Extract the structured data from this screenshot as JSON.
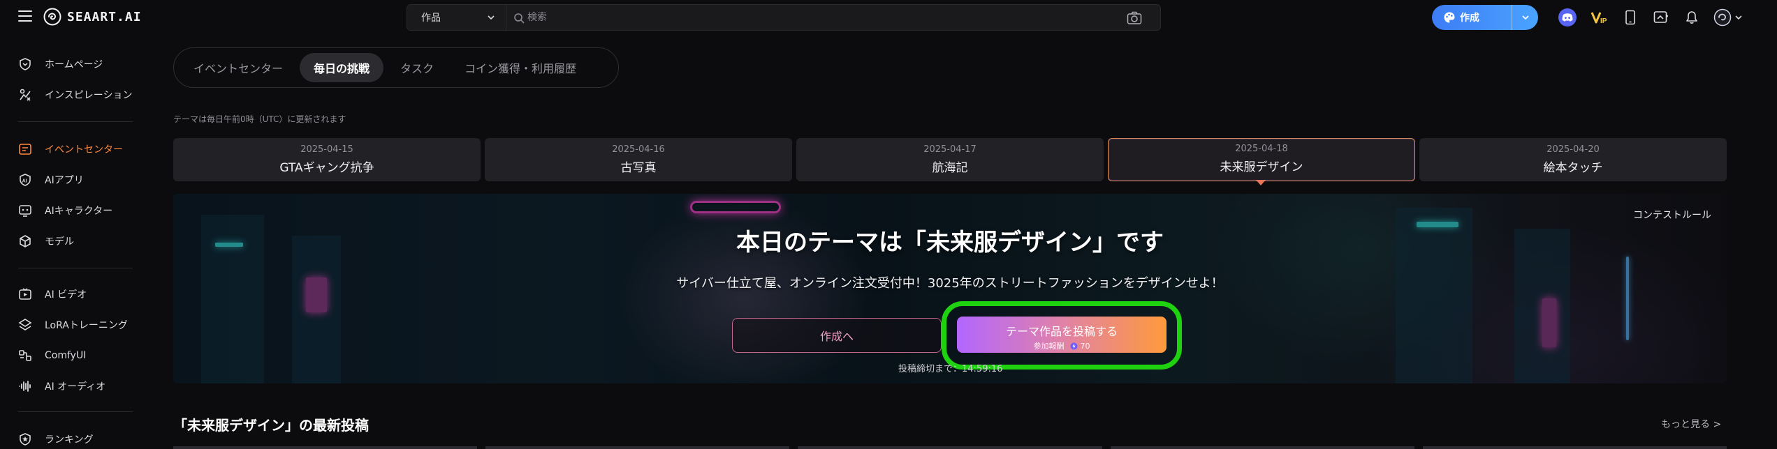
{
  "header": {
    "logo_text": "SEAART.AI",
    "search_type": "作品",
    "search_placeholder": "検索",
    "create_label": "作成"
  },
  "sidebar": {
    "items": [
      {
        "label": "ホームページ",
        "icon": "home-icon"
      },
      {
        "label": "インスピレーション",
        "icon": "inspiration-icon"
      },
      {
        "label": "イベントセンター",
        "icon": "event-center-icon",
        "active": true
      },
      {
        "label": "AIアプリ",
        "icon": "ai-app-icon"
      },
      {
        "label": "AIキャラクター",
        "icon": "ai-character-icon"
      },
      {
        "label": "モデル",
        "icon": "model-icon"
      },
      {
        "label": "AI ビデオ",
        "icon": "ai-video-icon"
      },
      {
        "label": "LoRAトレーニング",
        "icon": "lora-training-icon"
      },
      {
        "label": "ComfyUI",
        "icon": "comfyui-icon"
      },
      {
        "label": "AI オーディオ",
        "icon": "ai-audio-icon"
      },
      {
        "label": "ランキング",
        "icon": "ranking-icon"
      }
    ]
  },
  "tabs": [
    {
      "label": "イベントセンター"
    },
    {
      "label": "毎日の挑戦",
      "active": true
    },
    {
      "label": "タスク"
    },
    {
      "label": "コイン獲得・利用履歴"
    }
  ],
  "update_note": "テーマは毎日午前0時（UTC）に更新されます",
  "daily_themes": [
    {
      "date": "2025-04-15",
      "title": "GTAギャング抗争"
    },
    {
      "date": "2025-04-16",
      "title": "古写真"
    },
    {
      "date": "2025-04-17",
      "title": "航海記"
    },
    {
      "date": "2025-04-18",
      "title": "未来服デザイン",
      "active": true
    },
    {
      "date": "2025-04-20",
      "title": "絵本タッチ"
    }
  ],
  "hero": {
    "contest_rule": "コンテストルール",
    "title": "本日のテーマは「未来服デザイン」です",
    "subtitle": "サイバー仕立て屋、オンライン注文受付中！3025年のストリートファッションをデザインせよ！",
    "goto_button": "作成へ",
    "submit_button": "テーマ作品を投稿する",
    "submit_reward_label": "参加報酬",
    "submit_reward_value": "70",
    "deadline": "投稿締切まで：14:59:16"
  },
  "latest": {
    "title": "「未来服デザイン」の最新投稿",
    "more": "もっと見る >"
  },
  "colors": {
    "accent_orange": "#ff8a3d",
    "create_blue": "#3d7cf5",
    "highlight_green": "#1ed20f"
  }
}
